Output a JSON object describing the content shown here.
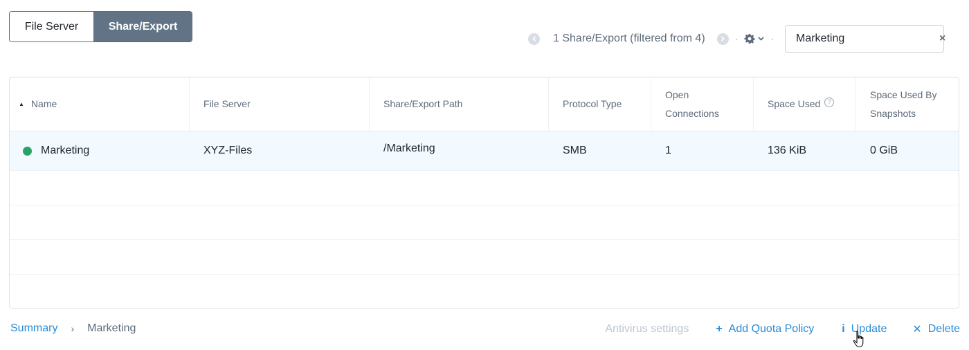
{
  "toggle": {
    "file_server": "File Server",
    "share_export": "Share/Export"
  },
  "toolbar": {
    "count_text": "1 Share/Export (filtered from 4)",
    "separator": "·",
    "search_value": "Marketing",
    "clear_icon": "×"
  },
  "table": {
    "columns": [
      {
        "label": "Name"
      },
      {
        "label": "File Server"
      },
      {
        "label": "Share/Export Path"
      },
      {
        "label": "Protocol Type"
      },
      {
        "label": "Open Connections"
      },
      {
        "label": "Space Used"
      },
      {
        "label": "Space Used By Snapshots"
      }
    ],
    "sort_indicator": "▲",
    "help_glyph": "?",
    "rows": [
      {
        "name": "Marketing",
        "status_color": "#29a36a",
        "file_server": "XYZ-Files",
        "path": "/Marketing",
        "protocol": "SMB",
        "open_connections": "1",
        "space_used": "136 KiB",
        "space_used_by_snapshots": "0 GiB"
      }
    ]
  },
  "breadcrumb": {
    "root": "Summary",
    "separator": "›",
    "current": "Marketing"
  },
  "actions": {
    "antivirus": "Antivirus settings",
    "add_quota": "Add Quota Policy",
    "add_quota_icon": "+",
    "update": "Update",
    "update_icon": "i",
    "delete": "Delete",
    "delete_icon": "✕"
  },
  "colors": {
    "accent": "#2a8bd6",
    "toggle_active": "#627386",
    "row_selected": "#f2f9ff",
    "status_ok": "#29a36a"
  }
}
